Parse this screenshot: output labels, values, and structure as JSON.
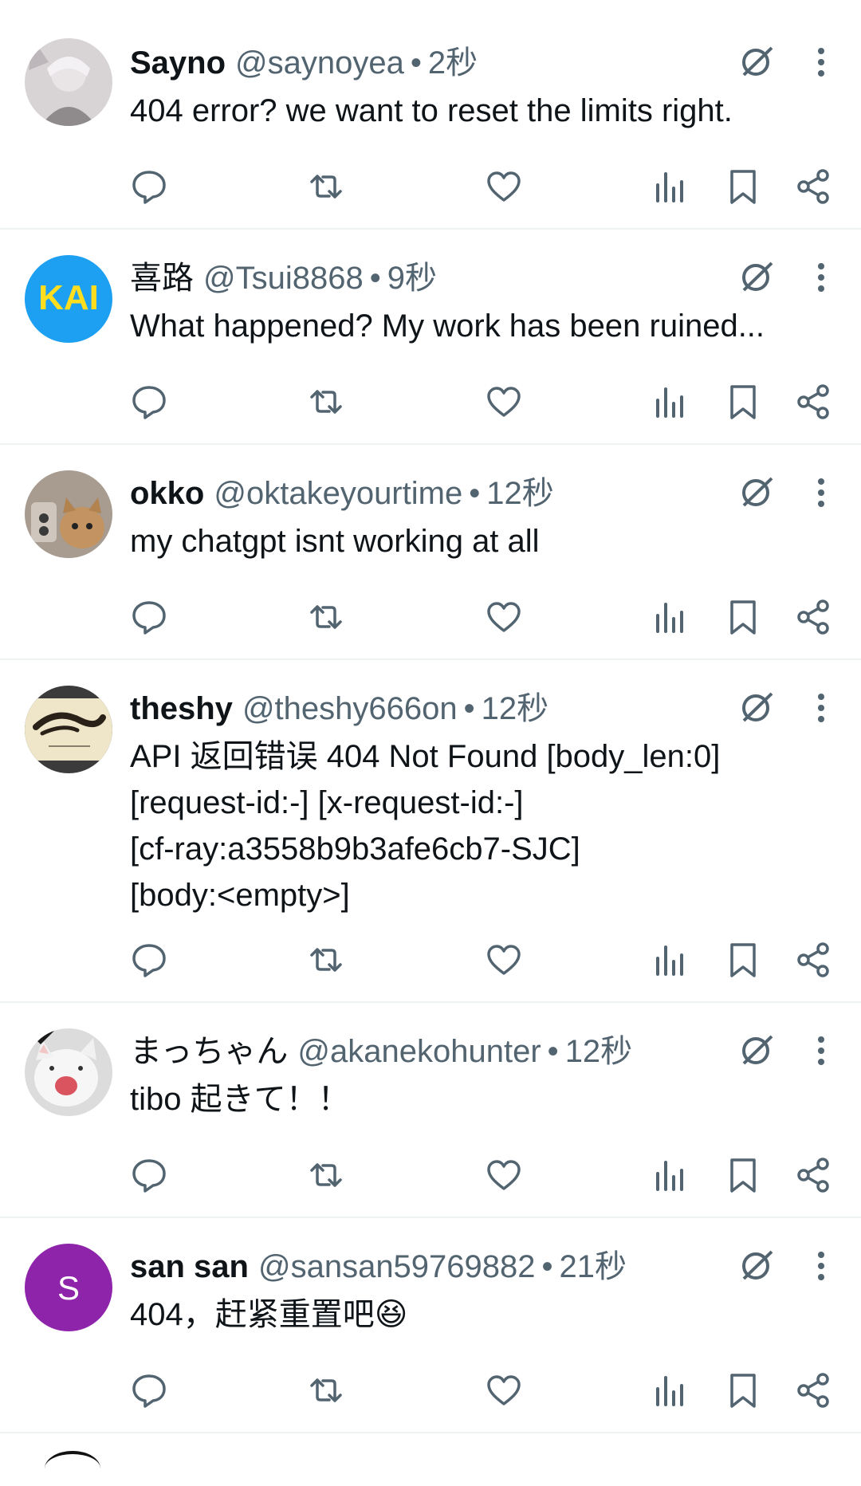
{
  "colors": {
    "text": "#0f1419",
    "secondary": "#536471",
    "divider": "#eff3f4",
    "icon": "#536471"
  },
  "icons": {
    "reply": "reply-icon",
    "repost": "repost-icon",
    "like": "like-icon",
    "views": "views-icon",
    "bookmark": "bookmark-icon",
    "share": "share-icon",
    "grok": "grok-icon",
    "more": "more-icon"
  },
  "posts": [
    {
      "name": "Sayno",
      "handle": "@saynoyea",
      "separator": "•",
      "time": "2秒",
      "text": "404 error? we want to reset the limits right."
    },
    {
      "name": "喜路",
      "handle": "@Tsui8868",
      "separator": "•",
      "time": "9秒",
      "text": "What happened? My work has been ruined...",
      "avatar_text": "KAI"
    },
    {
      "name": "okko",
      "handle": "@oktakeyourtime",
      "separator": "•",
      "time": "12秒",
      "text": "my chatgpt isnt working at all"
    },
    {
      "name": "theshy",
      "handle": "@theshy666on",
      "separator": "•",
      "time": "12秒",
      "text": "API 返回错误 404 Not Found [body_len:0]\n[request-id:-] [x-request-id:-]\n[cf-ray:a3558b9b3afe6cb7-SJC]\n[body:<empty>]"
    },
    {
      "name": "まっちゃん",
      "handle": "@akanekohunter",
      "separator": "•",
      "time": "12秒",
      "text": "tibo 起きて！！"
    },
    {
      "name": "san san",
      "handle": "@sansan59769882",
      "separator": "•",
      "time": "21秒",
      "text": "404，赶紧重置吧😆",
      "avatar_text": "S"
    }
  ]
}
